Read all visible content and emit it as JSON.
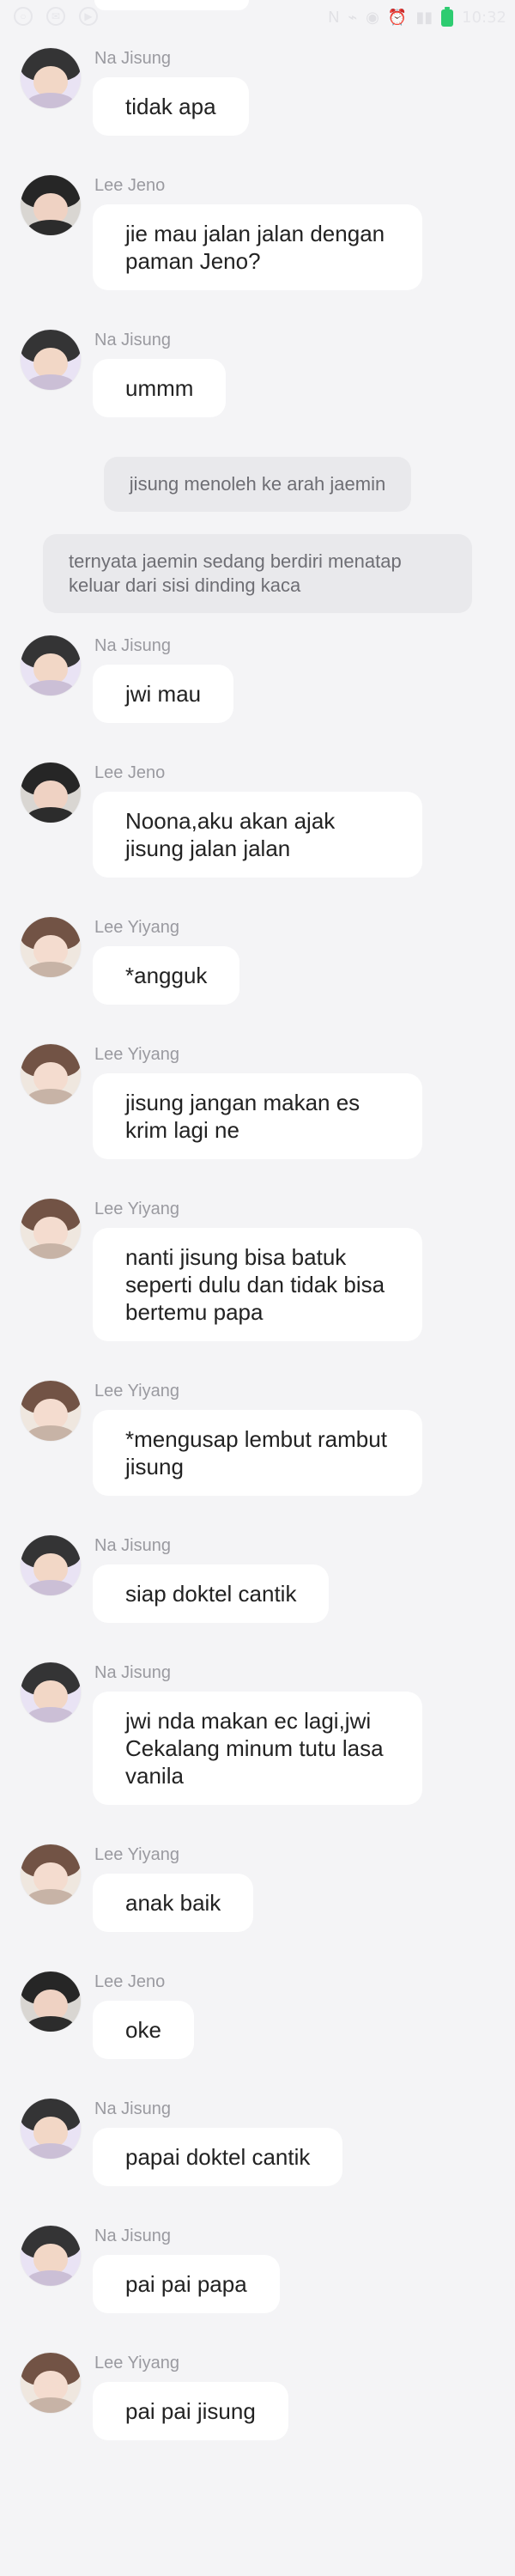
{
  "status_bar": {
    "time": "10:32",
    "left_icons": [
      "circle-icon",
      "message-icon",
      "video-icon"
    ],
    "right_icons": [
      "nfc-icon",
      "wifi-icon",
      "notification-icon",
      "alarm-icon",
      "signal-icon",
      "battery-icon"
    ]
  },
  "messages": [
    {
      "type": "msg",
      "sender": "Na Jisung",
      "text": "tidak apa",
      "avatar": "jisung"
    },
    {
      "type": "msg",
      "sender": "Lee Jeno",
      "text": "jie mau jalan jalan dengan paman Jeno?",
      "avatar": "jeno",
      "wide": true
    },
    {
      "type": "msg",
      "sender": "Na Jisung",
      "text": "ummm",
      "avatar": "jisung"
    },
    {
      "type": "sys",
      "text": "jisung menoleh ke arah jaemin"
    },
    {
      "type": "sys_wide",
      "text": "ternyata jaemin sedang berdiri menatap keluar dari sisi dinding kaca"
    },
    {
      "type": "msg",
      "sender": "Na Jisung",
      "text": "jwi mau",
      "avatar": "jisung"
    },
    {
      "type": "msg",
      "sender": "Lee Jeno",
      "text": "Noona,aku akan ajak jisung jalan jalan",
      "avatar": "jeno",
      "wide": true
    },
    {
      "type": "msg",
      "sender": "Lee Yiyang",
      "text": "*angguk",
      "avatar": "yiyang"
    },
    {
      "type": "msg",
      "sender": "Lee Yiyang",
      "text": "jisung jangan makan es krim lagi ne",
      "avatar": "yiyang",
      "wide": true
    },
    {
      "type": "msg",
      "sender": "Lee Yiyang",
      "text": "nanti jisung bisa batuk seperti dulu dan tidak bisa bertemu papa",
      "avatar": "yiyang",
      "wide": true
    },
    {
      "type": "msg",
      "sender": "Lee Yiyang",
      "text": "*mengusap lembut rambut jisung",
      "avatar": "yiyang",
      "wide": true
    },
    {
      "type": "msg",
      "sender": "Na Jisung",
      "text": "siap doktel cantik",
      "avatar": "jisung"
    },
    {
      "type": "msg",
      "sender": "Na Jisung",
      "text": "jwi nda makan ec lagi,jwi Cekalang minum tutu lasa vanila",
      "avatar": "jisung",
      "wide": true
    },
    {
      "type": "msg",
      "sender": "Lee Yiyang",
      "text": "anak baik",
      "avatar": "yiyang"
    },
    {
      "type": "msg",
      "sender": "Lee Jeno",
      "text": "oke",
      "avatar": "jeno"
    },
    {
      "type": "msg",
      "sender": "Na Jisung",
      "text": "papai doktel cantik",
      "avatar": "jisung"
    },
    {
      "type": "msg",
      "sender": "Na Jisung",
      "text": "pai pai papa",
      "avatar": "jisung"
    },
    {
      "type": "msg",
      "sender": "Lee Yiyang",
      "text": "pai pai jisung",
      "avatar": "yiyang"
    }
  ],
  "avatar_colors": {
    "jisung": {
      "bg": "#e9e3f4",
      "hair": "#2a2a2a",
      "face": "#f2d7c6",
      "shoulders": "#cbbfd6"
    },
    "jeno": {
      "bg": "#d9d6d2",
      "hair": "#1c1c1c",
      "face": "#efd2c3",
      "shoulders": "#2c2c2c"
    },
    "yiyang": {
      "bg": "#efe7df",
      "hair": "#6a4b3c",
      "face": "#f4dccf",
      "shoulders": "#c7b3a6"
    }
  }
}
